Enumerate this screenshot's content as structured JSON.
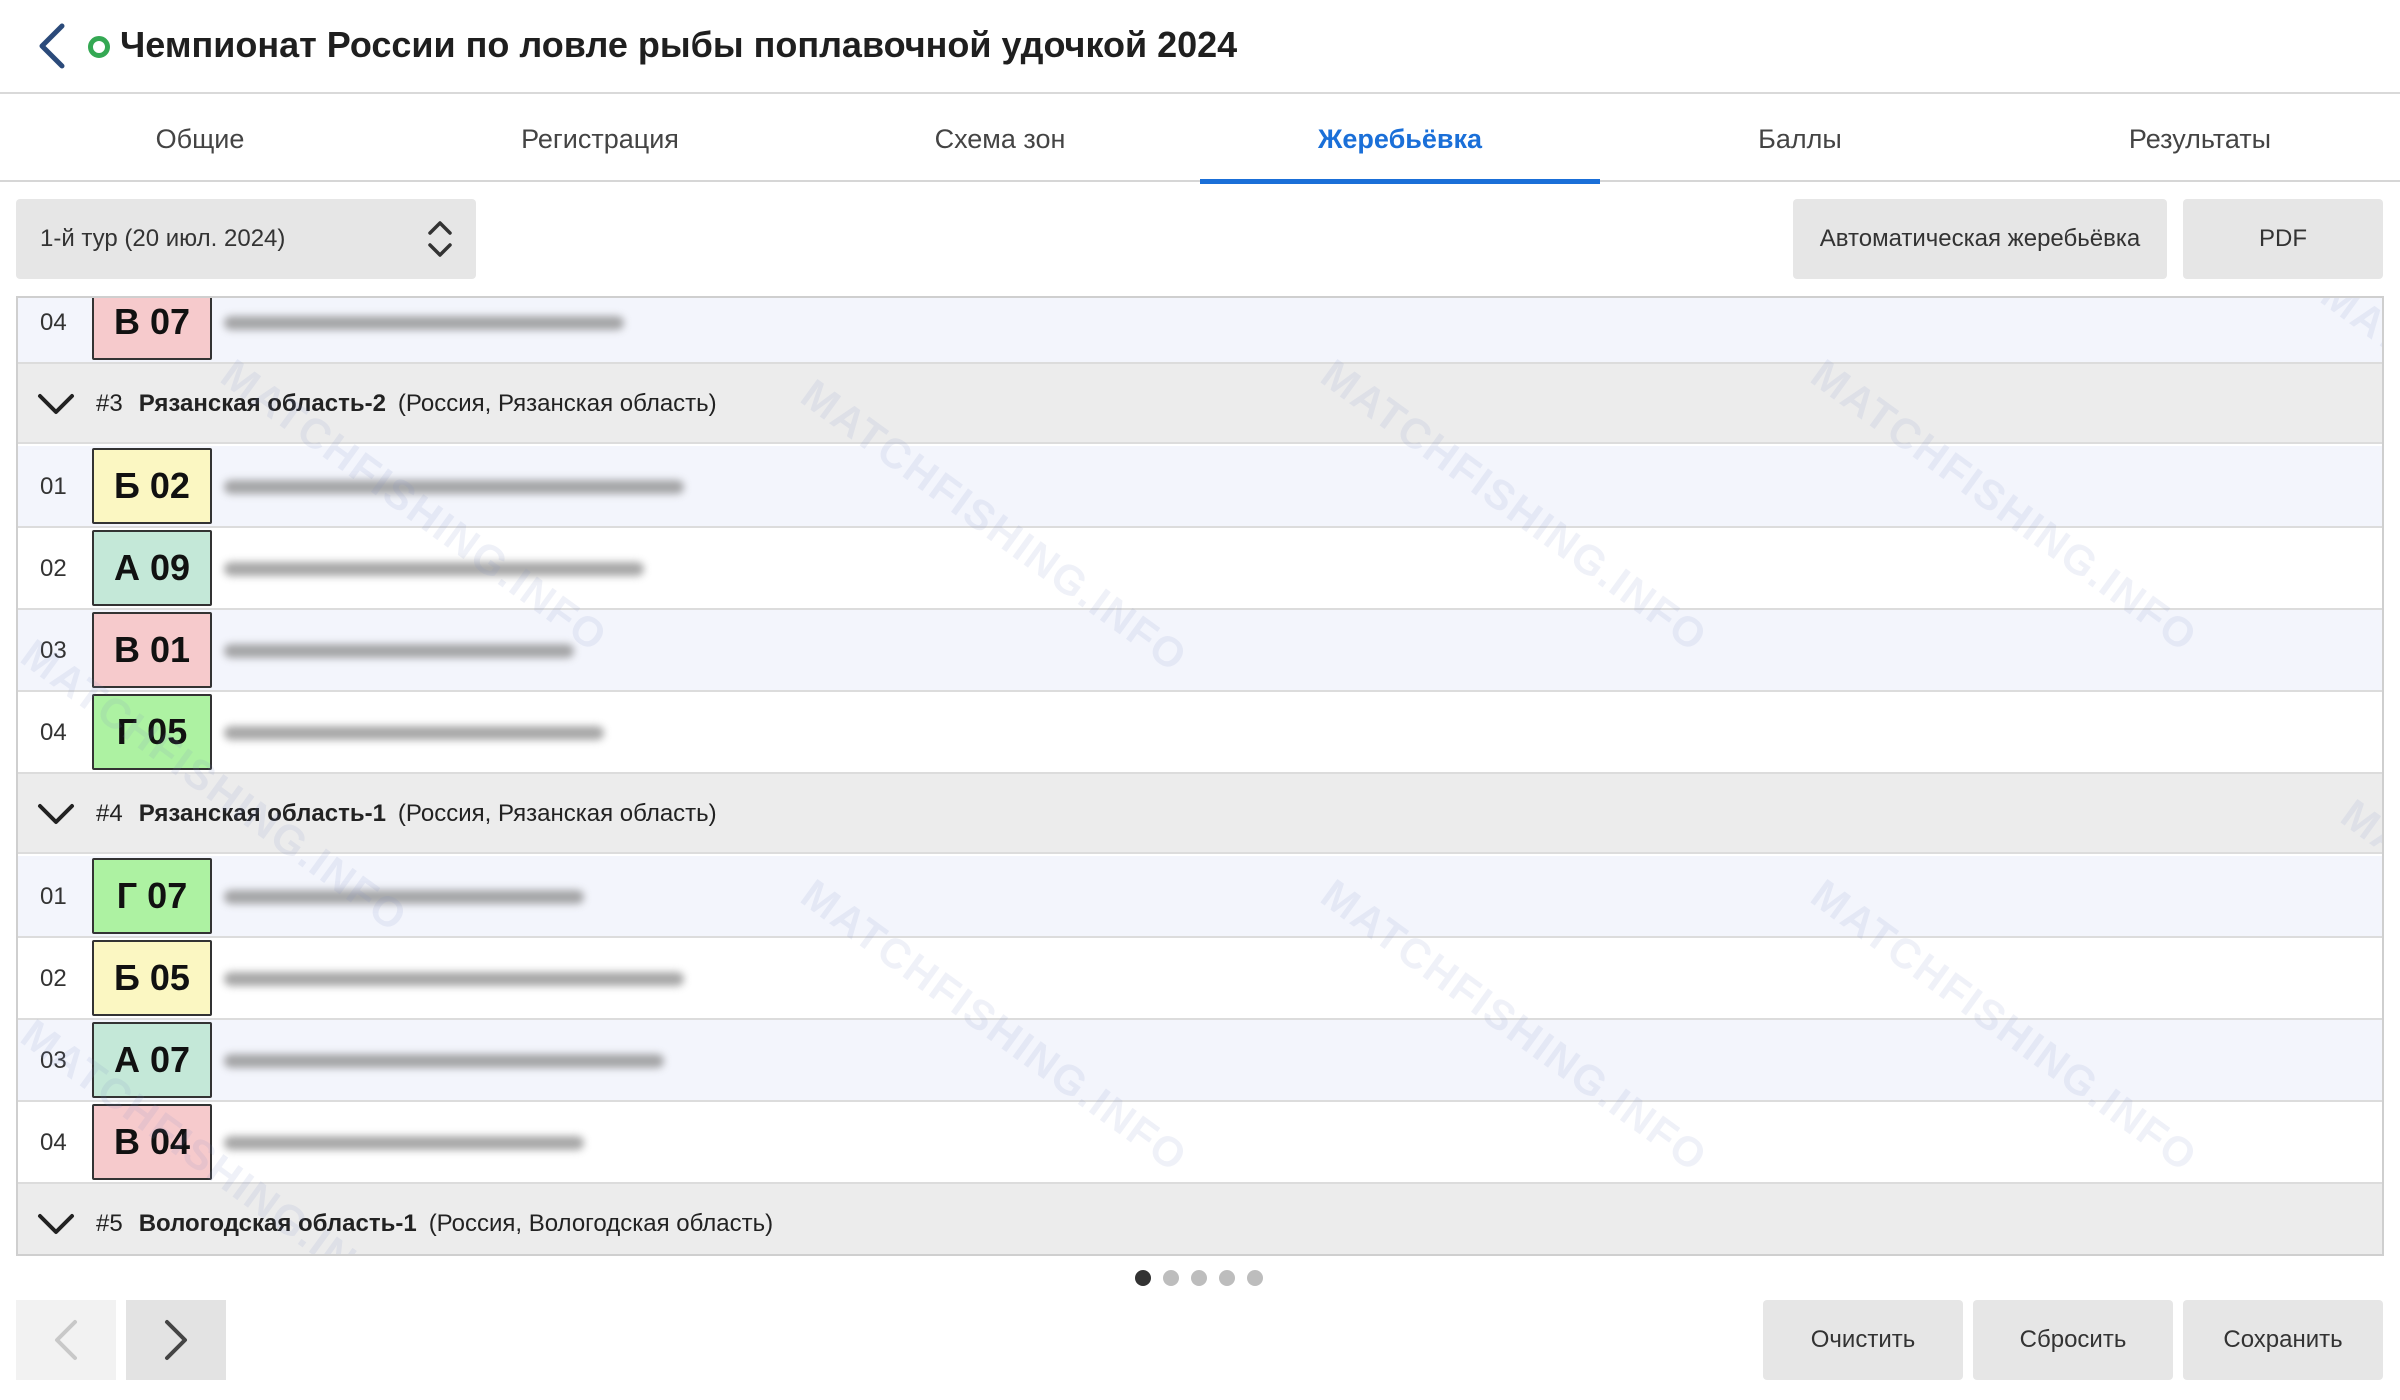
{
  "header": {
    "title": "Чемпионат России по ловле рыбы поплавочной удочкой 2024",
    "status_color": "#34a853"
  },
  "tabs": [
    {
      "label": "Общие",
      "active": false
    },
    {
      "label": "Регистрация",
      "active": false
    },
    {
      "label": "Схема зон",
      "active": false
    },
    {
      "label": "Жеребьёвка",
      "active": true
    },
    {
      "label": "Баллы",
      "active": false
    },
    {
      "label": "Результаты",
      "active": false
    }
  ],
  "toolbar": {
    "round": "1-й тур (20 июл. 2024)",
    "auto_draw_label": "Автоматическая жеребьёвка",
    "pdf_label": "PDF"
  },
  "zone_colors": {
    "А": "#c4e8d8",
    "Б": "#fbf7c2",
    "В": "#f6cacc",
    "Г": "#adf2a2"
  },
  "list": {
    "leading_rows": [
      {
        "num": "04",
        "sector": "В 07",
        "zone": "В"
      }
    ],
    "teams": [
      {
        "index": "#3",
        "name": "Рязанская область-2",
        "region": "(Россия, Рязанская область)",
        "members": [
          {
            "num": "01",
            "sector": "Б 02",
            "zone": "Б"
          },
          {
            "num": "02",
            "sector": "А 09",
            "zone": "А"
          },
          {
            "num": "03",
            "sector": "В 01",
            "zone": "В"
          },
          {
            "num": "04",
            "sector": "Г 05",
            "zone": "Г"
          }
        ]
      },
      {
        "index": "#4",
        "name": "Рязанская область-1",
        "region": "(Россия, Рязанская область)",
        "members": [
          {
            "num": "01",
            "sector": "Г 07",
            "zone": "Г"
          },
          {
            "num": "02",
            "sector": "Б 05",
            "zone": "Б"
          },
          {
            "num": "03",
            "sector": "А 07",
            "zone": "А"
          },
          {
            "num": "04",
            "sector": "В 04",
            "zone": "В"
          }
        ]
      },
      {
        "index": "#5",
        "name": "Вологодская область-1",
        "region": "(Россия, Вологодская область)",
        "members": []
      }
    ],
    "watermark": "MATCHFISHING.INFO"
  },
  "pagination": {
    "pages": 5,
    "current": 1
  },
  "footer": {
    "clear_label": "Очистить",
    "reset_label": "Сбросить",
    "save_label": "Сохранить"
  }
}
